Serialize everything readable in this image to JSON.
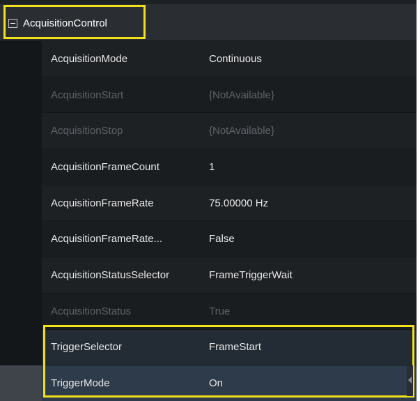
{
  "category": {
    "title": "AcquisitionControl",
    "icon": "collapse-minus-icon",
    "highlight_color": "#f2e11a"
  },
  "features": [
    {
      "name": "AcquisitionMode",
      "value": "Continuous",
      "enabled": true
    },
    {
      "name": "AcquisitionStart",
      "value": "{NotAvailable}",
      "enabled": false
    },
    {
      "name": "AcquisitionStop",
      "value": "{NotAvailable}",
      "enabled": false
    },
    {
      "name": "AcquisitionFrameCount",
      "value": "1",
      "enabled": true
    },
    {
      "name": "AcquisitionFrameRate",
      "value": "75.00000 Hz",
      "enabled": true
    },
    {
      "name": "AcquisitionFrameRate...",
      "value": "False",
      "enabled": true
    },
    {
      "name": "AcquisitionStatusSelector",
      "value": "FrameTriggerWait",
      "enabled": true
    },
    {
      "name": "AcquisitionStatus",
      "value": "True",
      "enabled": false
    },
    {
      "name": "TriggerSelector",
      "value": "FrameStart",
      "enabled": true
    },
    {
      "name": "TriggerMode",
      "value": "On",
      "enabled": true
    }
  ]
}
